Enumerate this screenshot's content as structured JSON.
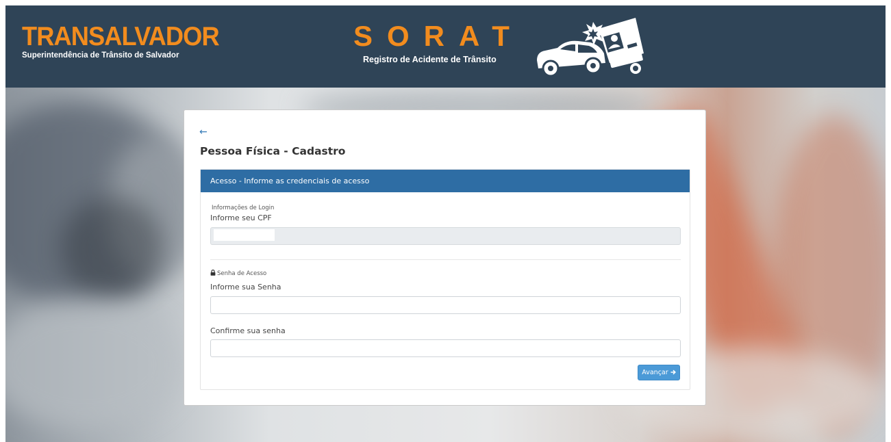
{
  "header": {
    "brand_name": "TRANSALVADOR",
    "brand_subtitle": "Superintendência de Trânsito de Salvador",
    "app_title": "SORAT",
    "app_subtitle": "Registro de Acidente de Trânsito",
    "illustration_icon": "car-crash-icon"
  },
  "card": {
    "back_icon": "arrow-left-icon",
    "back_glyph": "←",
    "title": "Pessoa Física - Cadastro",
    "panel_heading": "Acesso - Informe as credenciais de acesso",
    "login_section_label": "Informações de Login",
    "cpf_label": "Informe seu CPF",
    "cpf_value": "",
    "password_section_icon": "lock-icon",
    "password_section_label": "Senha de Acesso",
    "password_label": "Informe sua Senha",
    "password_value": "",
    "confirm_label": "Confirme sua senha",
    "confirm_value": "",
    "next_button_label": "Avançar",
    "next_button_icon": "arrow-right-icon"
  },
  "colors": {
    "header_bg": "#2f4457",
    "brand_orange": "#f28c1e",
    "panel_heading_bg": "#2e6da4",
    "button_bg": "#4b9ad7",
    "link_blue": "#337ab7"
  }
}
